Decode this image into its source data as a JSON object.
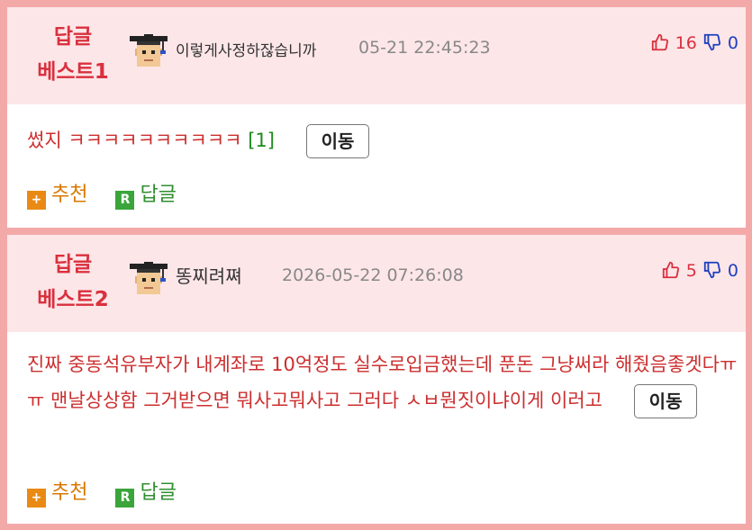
{
  "comments": [
    {
      "best_label_line1": "답글",
      "best_label_line2": "베스트1",
      "nickname": "이렇게사정하잖습니까",
      "timestamp": "05-21 22:45:23",
      "upvotes": "16",
      "downvotes": "0",
      "text": "썼지 ㅋㅋㅋㅋㅋㅋㅋㅋㅋㅋ",
      "reply_ref": "[1]",
      "move_label": "이동",
      "recommend_label": "추천",
      "reply_label": "답글"
    },
    {
      "best_label_line1": "답글",
      "best_label_line2": "베스트2",
      "nickname": "똥찌려쪄",
      "timestamp": "2026-05-22 07:26:08",
      "upvotes": "5",
      "downvotes": "0",
      "text": "진짜 중동석유부자가 내계좌로 10억정도 실수로입금했는데 푼돈 그냥써라 해줬음좋겟다ㅠㅠ 맨날상상함 그거받으면 뭐사고뭐사고 그러다 ㅅㅂ뭔짓이냐이게 이러고",
      "move_label": "이동",
      "recommend_label": "추천",
      "reply_label": "답글"
    }
  ],
  "icons": {
    "thumbs_up": "thumbs-up-icon",
    "thumbs_down": "thumbs-down-icon",
    "avatar": "avatar-graduate",
    "recommend": "plus-icon",
    "reply": "r-icon"
  },
  "colors": {
    "best_label": "#d9303e",
    "header_bg": "#fde6e8",
    "border": "#f4a9a9",
    "body_text": "#cc2f2f",
    "reply_ref": "#1f8b1f",
    "recommend": "#d97700",
    "reply": "#2f8f2f",
    "downvote": "#1f3fbf"
  }
}
